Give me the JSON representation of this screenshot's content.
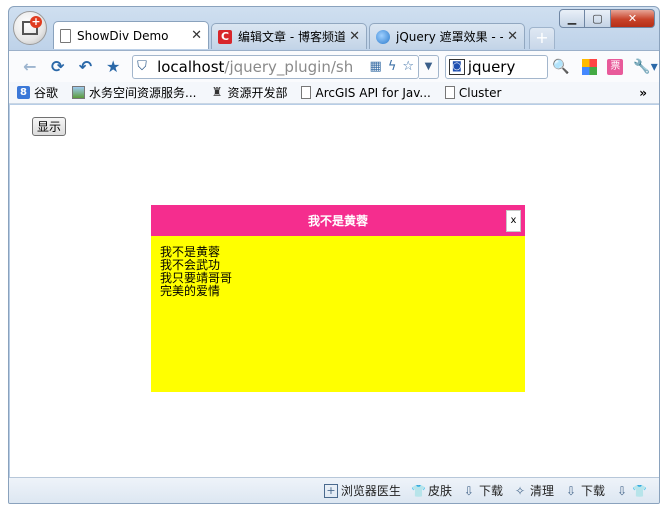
{
  "tabs": [
    {
      "title": "ShowDiv Demo",
      "icon": "document-icon",
      "close": "✕",
      "active": true
    },
    {
      "title": "编辑文章 - 博客频道 - ",
      "icon": "csdn-icon",
      "close": "✕",
      "active": false
    },
    {
      "title": "jQuery 遮罩效果 - - I",
      "icon": "jquery-site-icon",
      "close": "✕",
      "active": false
    }
  ],
  "address": {
    "host": "localhost",
    "path": "/jquery_plugin/sh"
  },
  "search": {
    "value": "jquery"
  },
  "bookmarks": [
    {
      "label": "谷歌",
      "icon": "google-8-icon"
    },
    {
      "label": "水务空间资源服务...",
      "icon": "picture-icon"
    },
    {
      "label": "资源开发部",
      "icon": "person-icon"
    },
    {
      "label": "ArcGIS API for Jav...",
      "icon": "document-icon"
    },
    {
      "label": "Cluster",
      "icon": "document-icon"
    }
  ],
  "bookmarks_more": "»",
  "page": {
    "show_button": "显示"
  },
  "modal": {
    "title": "我不是黄蓉",
    "close_label": "x",
    "lines": [
      "我不是黄蓉",
      "我不会武功",
      "我只要靖哥哥",
      "完美的爱情"
    ],
    "header_color": "#f52d8e",
    "body_color": "#ffff00"
  },
  "statusbar": [
    {
      "label": "浏览器医生",
      "icon": "doctor-plus-icon"
    },
    {
      "label": "皮肤",
      "icon": "shirt-icon"
    },
    {
      "label": "下载",
      "icon": "download-icon"
    },
    {
      "label": "清理",
      "icon": "broom-icon"
    },
    {
      "label": "下载",
      "icon": "download-icon"
    },
    {
      "label": "",
      "icon": "shirt-icon"
    }
  ]
}
